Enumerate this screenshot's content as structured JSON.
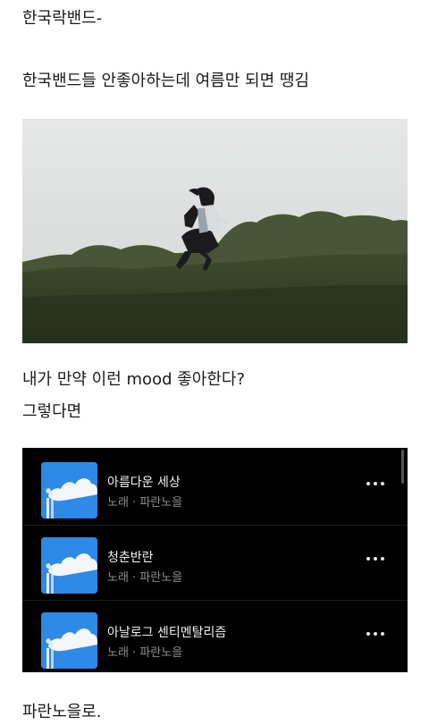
{
  "post": {
    "line1": "한국락밴드-",
    "line2": "한국밴드들 안좋아하는데 여름만 되면 땡김",
    "line3": "내가 만약 이런 mood 좋아한다?",
    "line4": "그렇다면",
    "line5": "파란노을로."
  },
  "music_list": {
    "items": [
      {
        "title": "아름다운 세상",
        "subtitle": "노래 · 파란노을",
        "more_icon": "more-horizontal-icon"
      },
      {
        "title": "청춘반란",
        "subtitle": "노래 · 파란노을",
        "more_icon": "more-horizontal-icon"
      },
      {
        "title": "아날로그 센티멘탈리즘",
        "subtitle": "노래 · 파란노을",
        "more_icon": "more-horizontal-icon"
      }
    ],
    "thumb_color": "#2d8ae6",
    "background": "#000000"
  }
}
